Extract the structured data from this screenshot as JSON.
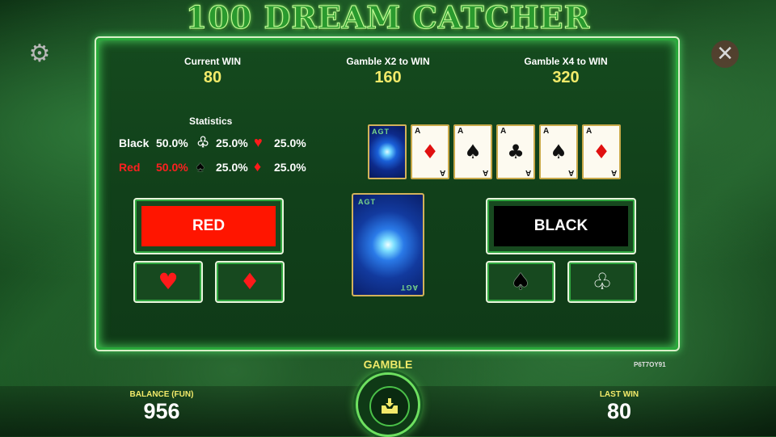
{
  "header": {
    "title": "100 DREAM CATCHER"
  },
  "icons": {
    "settings": "gear-icon",
    "close": "close-icon",
    "gamble": "collect-icon"
  },
  "wins": {
    "current": {
      "label": "Current WIN",
      "value": "80"
    },
    "x2": {
      "label": "Gamble X2 to WIN",
      "value": "160"
    },
    "x4": {
      "label": "Gamble X4 to WIN",
      "value": "320"
    }
  },
  "statistics": {
    "title": "Statistics",
    "black": {
      "label": "Black",
      "percent": "50.0%",
      "club": "25.0%",
      "heart": "25.0%"
    },
    "red": {
      "label": "Red",
      "percent": "50.0%",
      "spade": "25.0%",
      "diamond": "25.0%"
    }
  },
  "history": {
    "cards": [
      {
        "rank": "A",
        "suit": "♦",
        "color": "#e01010"
      },
      {
        "rank": "A",
        "suit": "♠",
        "color": "#111111"
      },
      {
        "rank": "A",
        "suit": "♣",
        "color": "#111111"
      },
      {
        "rank": "A",
        "suit": "♠",
        "color": "#111111"
      },
      {
        "rank": "A",
        "suit": "♦",
        "color": "#e01010"
      }
    ],
    "back_text": "AGT"
  },
  "buttons": {
    "red": "RED",
    "black": "BLACK",
    "hearts": "♥",
    "diamonds": "♦",
    "spades": "♠",
    "clubs": "♧"
  },
  "colors": {
    "red_button": "#ff1500",
    "black_button": "#000000",
    "accent_yellow": "#f2ea6a",
    "red_text": "#ff2020"
  },
  "footer": {
    "balance_label": "BALANCE (FUN)",
    "balance_value": "956",
    "gamble_label": "GAMBLE",
    "last_win_label": "LAST WIN",
    "last_win_value": "80",
    "session_code": "P6T7OY91"
  }
}
